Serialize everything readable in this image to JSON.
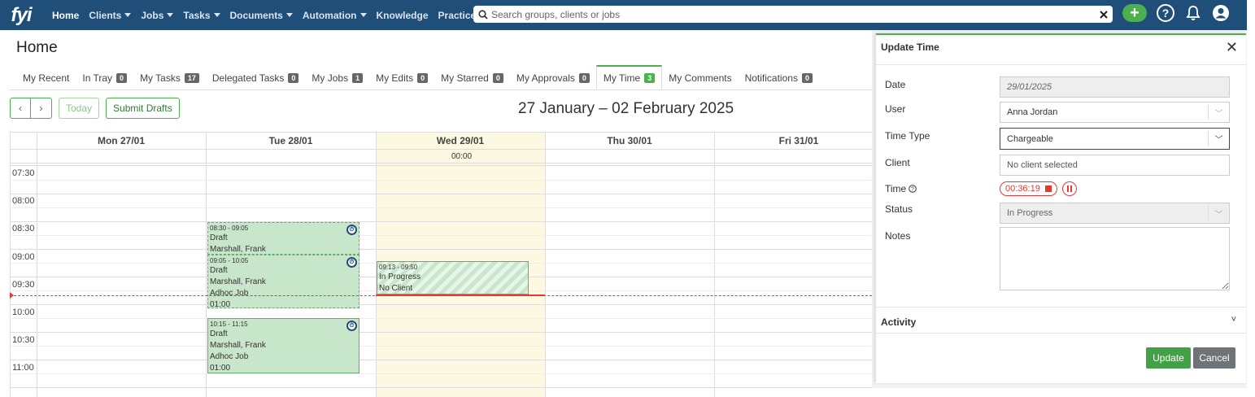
{
  "nav": {
    "logo": "fyi",
    "items": [
      {
        "label": "Home",
        "caret": false,
        "active": true
      },
      {
        "label": "Clients",
        "caret": true
      },
      {
        "label": "Jobs",
        "caret": true
      },
      {
        "label": "Tasks",
        "caret": true
      },
      {
        "label": "Documents",
        "caret": true
      },
      {
        "label": "Automation",
        "caret": true
      },
      {
        "label": "Knowledge",
        "caret": false
      },
      {
        "label": "Practice",
        "caret": false
      }
    ],
    "search_placeholder": "Search groups, clients or jobs"
  },
  "home": {
    "title": "Home",
    "tabs": [
      {
        "label": "My Recent",
        "badge": null
      },
      {
        "label": "In Tray",
        "badge": "0"
      },
      {
        "label": "My Tasks",
        "badge": "17"
      },
      {
        "label": "Delegated Tasks",
        "badge": "0"
      },
      {
        "label": "My Jobs",
        "badge": "1"
      },
      {
        "label": "My Edits",
        "badge": "0"
      },
      {
        "label": "My Starred",
        "badge": "0"
      },
      {
        "label": "My Approvals",
        "badge": "0"
      },
      {
        "label": "My Time",
        "badge": "3",
        "active": true
      },
      {
        "label": "My Comments",
        "badge": null
      },
      {
        "label": "Notifications",
        "badge": "0"
      }
    ]
  },
  "toolbar": {
    "prev": "‹",
    "next": "›",
    "today": "Today",
    "submit": "Submit Drafts",
    "week_title": "27 January – 02 February 2025"
  },
  "calendar": {
    "days": [
      "Mon 27/01",
      "Tue 28/01",
      "Wed 29/01",
      "Thu 30/01",
      "Fri 31/01"
    ],
    "allday_total": "00:00",
    "times": [
      "07:30",
      "08:00",
      "08:30",
      "09:00",
      "09:30",
      "10:00",
      "10:30",
      "11:00"
    ],
    "events": [
      {
        "time": "08:30 - 09:05",
        "lines": [
          "Draft",
          "Marshall, Frank"
        ]
      },
      {
        "time": "09:05 - 10:05",
        "lines": [
          "Draft",
          "Marshall, Frank",
          "Adhoc Job",
          "01:00"
        ]
      },
      {
        "time": "09:13 - 09:50",
        "lines": [
          "In Progress",
          "No Client"
        ]
      },
      {
        "time": "10:15 - 11:15",
        "lines": [
          "Draft",
          "Marshall, Frank",
          "Adhoc Job",
          "01:00"
        ]
      }
    ]
  },
  "panel": {
    "title": "Update Time",
    "labels": {
      "date": "Date",
      "user": "User",
      "time_type": "Time Type",
      "client": "Client",
      "time": "Time",
      "status": "Status",
      "notes": "Notes"
    },
    "values": {
      "date": "29/01/2025",
      "user": "Anna Jordan",
      "time_type": "Chargeable",
      "client_placeholder": "No client selected",
      "timer": "00:36:19",
      "status": "In Progress"
    },
    "activity": "Activity",
    "update": "Update",
    "cancel": "Cancel"
  },
  "colors": {
    "nav_bg": "#1f4e79",
    "accent": "#4caf50",
    "event_bg": "#c8e6c9",
    "today_bg": "#fdf8e1",
    "timer_red": "#e53935"
  }
}
